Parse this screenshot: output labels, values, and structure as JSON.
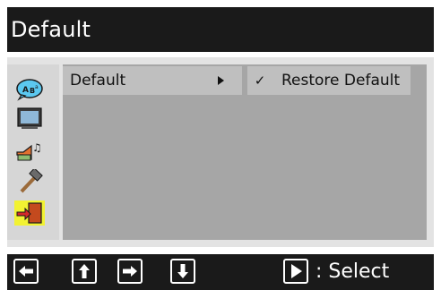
{
  "window": {
    "title": "Default"
  },
  "sidebar": {
    "icons": [
      {
        "name": "language-icon"
      },
      {
        "name": "picture-icon"
      },
      {
        "name": "audio-icon"
      },
      {
        "name": "tools-icon"
      },
      {
        "name": "exit-icon"
      }
    ],
    "selected_index": 4
  },
  "menu": {
    "item_label": "Default",
    "submenu": {
      "check": "✓",
      "label": "Restore Default"
    }
  },
  "footer": {
    "nav_icons": [
      "left-arrow-icon",
      "up-arrow-icon",
      "right-arrow-icon",
      "down-arrow-icon"
    ],
    "play_icon": "play-icon",
    "hint": ": Select"
  },
  "colors": {
    "title_bar": "#1a1a1a",
    "panel": "#e3e3e3",
    "menu_area": "#a6a6a6",
    "highlight": "#bfbfbf",
    "exit_highlight": "#f2f232"
  }
}
